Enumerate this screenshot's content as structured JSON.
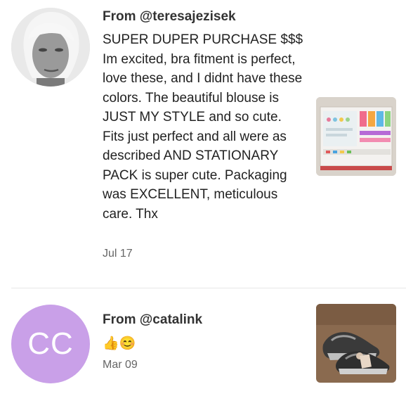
{
  "reviews": [
    {
      "from": "From @teresajezisek",
      "text": "SUPER DUPER PURCHASE $$$ Im excited, bra fitment is perfect, love these, and I didnt have these colors. The beautiful blouse is JUST MY STYLE and so cute. Fits just perfect and all were as described AND STATIONARY PACK is super cute. Packaging was EXCELLENT, meticulous care. Thx",
      "date": "Jul 17",
      "avatar_icon": "user-photo-avatar",
      "thumb_icon": "stationery-set-photo"
    },
    {
      "from": "From @catalink",
      "text": "👍😊",
      "date": "Mar 09",
      "avatar_initials": "CC",
      "avatar_color": "#c9a0e8",
      "thumb_icon": "sneakers-photo"
    }
  ]
}
